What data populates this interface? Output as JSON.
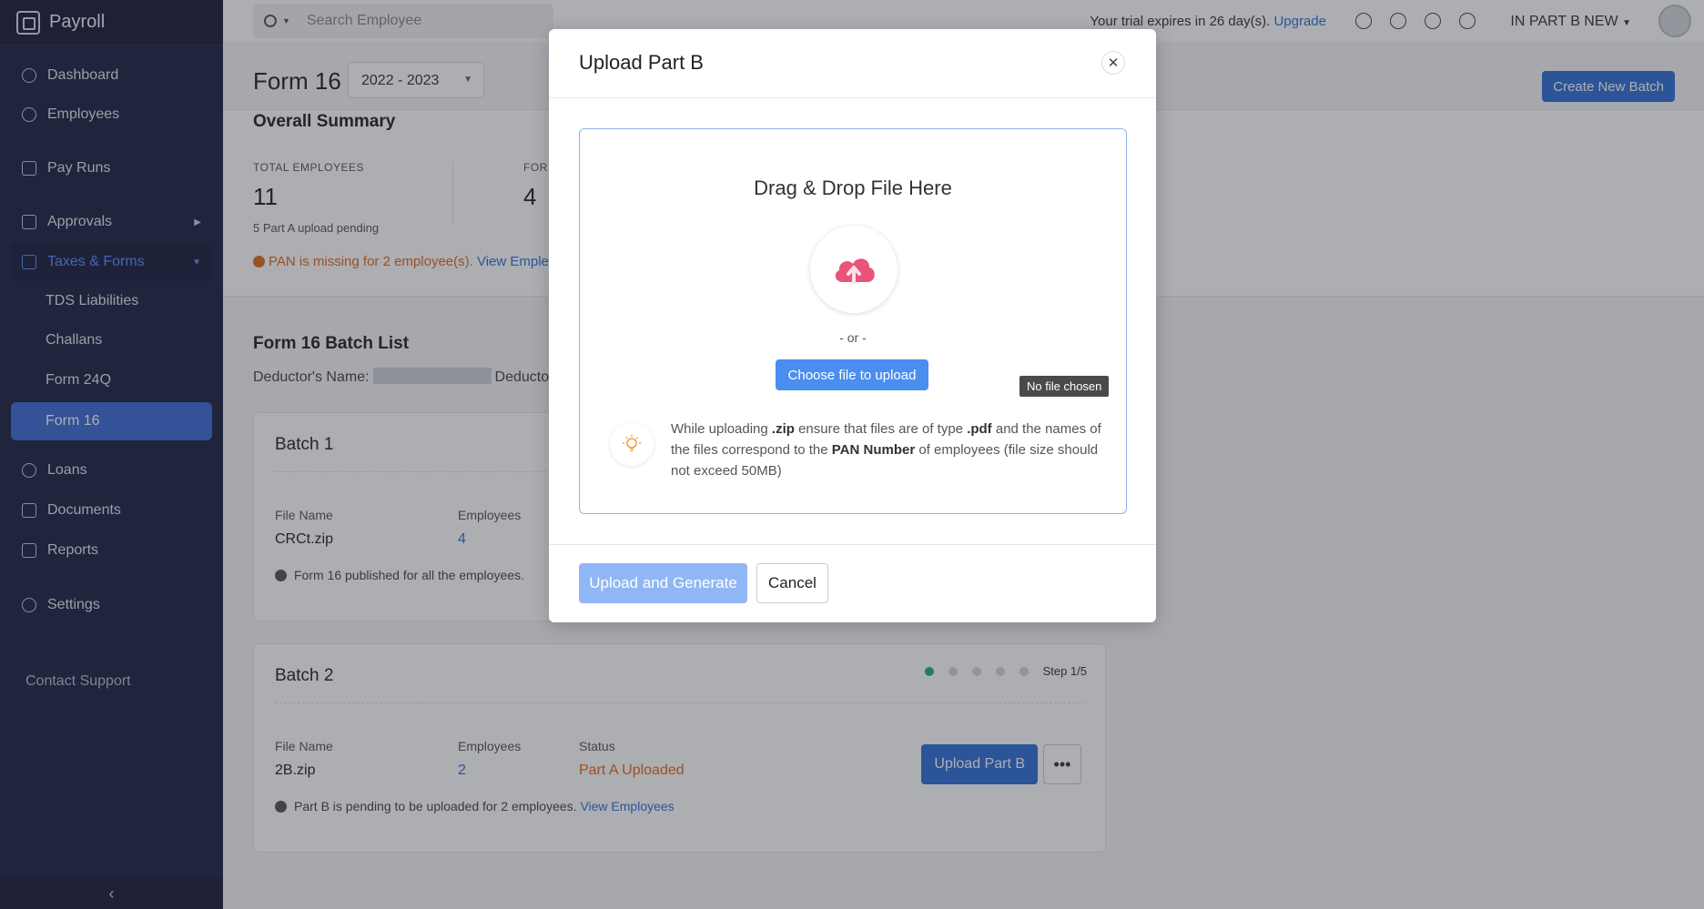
{
  "app": {
    "title": "Payroll"
  },
  "sidebar": {
    "items": [
      {
        "label": "Dashboard"
      },
      {
        "label": "Employees"
      },
      {
        "label": "Pay Runs"
      },
      {
        "label": "Approvals"
      },
      {
        "label": "Taxes & Forms"
      },
      {
        "label": "Loans"
      },
      {
        "label": "Documents"
      },
      {
        "label": "Reports"
      },
      {
        "label": "Settings"
      }
    ],
    "subitems": [
      {
        "label": "TDS Liabilities"
      },
      {
        "label": "Challans"
      },
      {
        "label": "Form 24Q"
      },
      {
        "label": "Form 16"
      }
    ],
    "contact": "Contact Support",
    "collapse_glyph": "‹"
  },
  "topbar": {
    "search_placeholder": "Search Employee",
    "trial_text": "Your trial expires in 26 day(s).",
    "upgrade_label": "Upgrade",
    "org_name": "IN PART B NEW"
  },
  "page": {
    "title": "Form 16",
    "year": "2022 - 2023",
    "create_batch_label": "Create New Batch"
  },
  "summary": {
    "title": "Overall Summary",
    "total_label": "TOTAL EMPLOYEES",
    "total_value": "11",
    "total_sub": "5 Part A upload pending",
    "form_label": "FORI",
    "form_value": "4",
    "pan_warning": "PAN is missing for 2 employee(s).",
    "pan_link": "View Emple"
  },
  "batch_list": {
    "title": "Form 16 Batch List",
    "deductor_label": "Deductor's Name:",
    "deductor_label2": "Deducto"
  },
  "batches": [
    {
      "name": "Batch 1",
      "file_label": "File Name",
      "file_value": "CRCt.zip",
      "emp_label": "Employees",
      "emp_value": "4",
      "note": "Form 16 published for all the employees."
    },
    {
      "name": "Batch 2",
      "file_label": "File Name",
      "file_value": "2B.zip",
      "emp_label": "Employees",
      "emp_value": "2",
      "status_label": "Status",
      "status_value": "Part A Uploaded",
      "step_text": "Step 1/5",
      "upload_label": "Upload Part B",
      "more_glyph": "•••",
      "note": "Part B is pending to be uploaded for 2 employees.",
      "note_link": "View Employees"
    }
  ],
  "modal": {
    "title": "Upload Part B",
    "close_glyph": "✕",
    "drop_title": "Drag & Drop File Here",
    "or_text": "- or -",
    "choose_label": "Choose file to upload",
    "tooltip": "No file chosen",
    "hint": {
      "p1": "While uploading ",
      "zip": ".zip",
      "p2": " ensure that files are of type ",
      "pdf": ".pdf",
      "p3": " and the names of the files correspond to the ",
      "pan": "PAN Number",
      "p4": " of employees (file size should not exceed 50MB)"
    },
    "upload_generate_label": "Upload and Generate",
    "cancel_label": "Cancel"
  },
  "colors": {
    "sidebar_bg": "#1c2142",
    "accent": "#2f6fd6",
    "warning": "#e06a1b",
    "cloud": "#e8547a",
    "success": "#2bae66"
  },
  "icons": [
    "search-icon",
    "bell-icon",
    "gear-icon",
    "help-icon",
    "users-icon",
    "cloud-upload-icon",
    "bulb-icon",
    "close-icon"
  ]
}
